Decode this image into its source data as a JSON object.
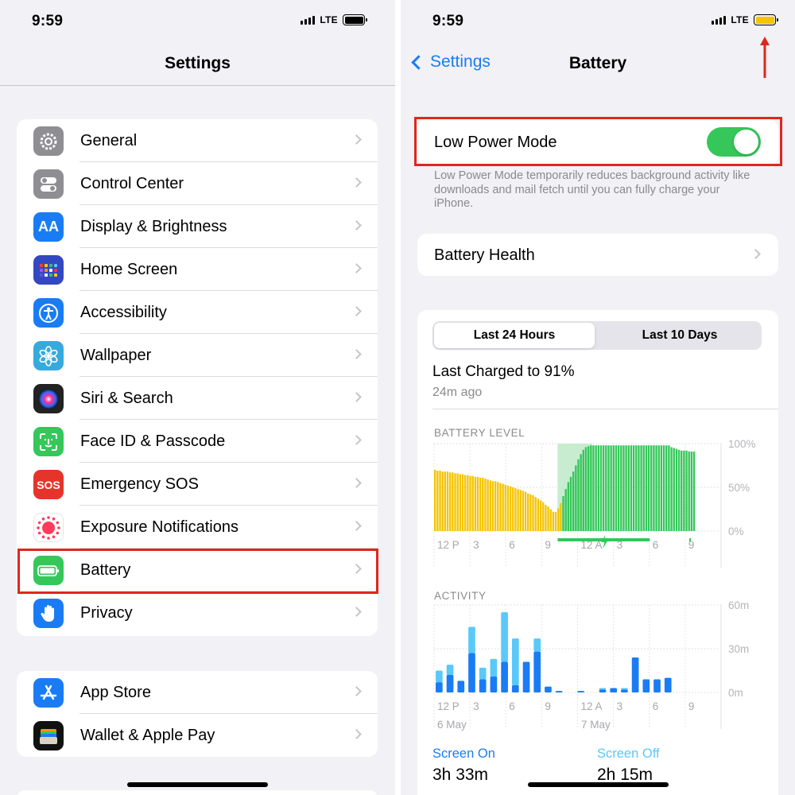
{
  "status": {
    "time": "9:59",
    "network": "LTE"
  },
  "left": {
    "nav_title": "Settings",
    "group1": [
      {
        "label": "General",
        "icon": "gear-icon",
        "color": "#8e8e93"
      },
      {
        "label": "Control Center",
        "icon": "switches-icon",
        "color": "#8e8e93"
      },
      {
        "label": "Display & Brightness",
        "icon": "text-size-icon",
        "icon_text": "AA",
        "color": "#1a7cf5"
      },
      {
        "label": "Home Screen",
        "icon": "app-grid-icon",
        "color": "#3447c2"
      },
      {
        "label": "Accessibility",
        "icon": "accessibility-icon",
        "color": "#1a7cf5"
      },
      {
        "label": "Wallpaper",
        "icon": "flower-icon",
        "color": "#36aadc"
      },
      {
        "label": "Siri & Search",
        "icon": "siri-icon",
        "color": "#222"
      },
      {
        "label": "Face ID & Passcode",
        "icon": "face-id-icon",
        "color": "#35c759"
      },
      {
        "label": "Emergency SOS",
        "icon": "sos-icon",
        "icon_text": "SOS",
        "color": "#e5352b"
      },
      {
        "label": "Exposure Notifications",
        "icon": "exposure-icon",
        "color": "#ffffff"
      },
      {
        "label": "Battery",
        "icon": "battery-icon",
        "color": "#35c759",
        "highlighted": true
      },
      {
        "label": "Privacy",
        "icon": "hand-icon",
        "color": "#1a7cf5"
      }
    ],
    "group2": [
      {
        "label": "App Store",
        "icon": "app-store-icon",
        "color": "#1a7cf5"
      },
      {
        "label": "Wallet & Apple Pay",
        "icon": "wallet-icon",
        "color": "#111"
      }
    ]
  },
  "right": {
    "back_label": "Settings",
    "nav_title": "Battery",
    "low_power": {
      "label": "Low Power Mode",
      "on": true,
      "description": "Low Power Mode temporarily reduces background activity like downloads and mail fetch until you can fully charge your iPhone."
    },
    "battery_health_label": "Battery Health",
    "tabs": [
      "Last 24 Hours",
      "Last 10 Days"
    ],
    "selected_tab": "Last 24 Hours",
    "last_charged": "Last Charged to 91%",
    "last_charged_ago": "24m ago",
    "screen_on": {
      "label": "Screen On",
      "value": "3h 33m"
    },
    "screen_off": {
      "label": "Screen Off",
      "value": "2h 15m"
    },
    "colors": {
      "accent": "#1a7cf5",
      "battery_yellow": "#f5c400",
      "battery_green": "#35c759",
      "screen_on": "#1a7cf5",
      "screen_off": "#5ac8fa",
      "highlight": "#e0261c"
    }
  },
  "chart_data": [
    {
      "type": "bar",
      "title": "BATTERY LEVEL",
      "ylim": [
        0,
        100
      ],
      "y_ticks": [
        "100%",
        "50%",
        "0%"
      ],
      "x_ticks": [
        "12 P",
        "3",
        "6",
        "9",
        "12 A",
        "3",
        "6",
        "9"
      ],
      "series": [
        {
          "name": "battery",
          "values": [
            70,
            69,
            69,
            68,
            68,
            68,
            67,
            67,
            66,
            66,
            65,
            65,
            64,
            64,
            63,
            63,
            62,
            62,
            61,
            61,
            60,
            59,
            58,
            57,
            57,
            56,
            55,
            54,
            53,
            52,
            51,
            50,
            49,
            48,
            47,
            46,
            45,
            43,
            42,
            41,
            39,
            37,
            35,
            33,
            30,
            28,
            25,
            22,
            22,
            26,
            32,
            40,
            48,
            56,
            62,
            68,
            75,
            82,
            88,
            93,
            96,
            97,
            98,
            98,
            98,
            98,
            98,
            98,
            98,
            98,
            98,
            98,
            98,
            98,
            98,
            98,
            98,
            98,
            98,
            98,
            98,
            98,
            98,
            98,
            98,
            98,
            98,
            98,
            98,
            98,
            98,
            98,
            98,
            98,
            96,
            95,
            94,
            93,
            92,
            92,
            92,
            91,
            91,
            91
          ],
          "charging": [
            false,
            false,
            false,
            false,
            false,
            false,
            false,
            false,
            false,
            false,
            false,
            false,
            false,
            false,
            false,
            false,
            false,
            false,
            false,
            false,
            false,
            false,
            false,
            false,
            false,
            false,
            false,
            false,
            false,
            false,
            false,
            false,
            false,
            false,
            false,
            false,
            false,
            false,
            false,
            false,
            false,
            false,
            false,
            false,
            false,
            false,
            false,
            false,
            false,
            false,
            false,
            true,
            true,
            true,
            true,
            true,
            true,
            true,
            true,
            true,
            true,
            true,
            true,
            true,
            true,
            true,
            true,
            true,
            true,
            true,
            true,
            true,
            true,
            true,
            true,
            true,
            true,
            true,
            true,
            true,
            true,
            true,
            true,
            true,
            true,
            true,
            true,
            true,
            true,
            true,
            true,
            true,
            true,
            true,
            true,
            true,
            true,
            true,
            true,
            true,
            true,
            true,
            true,
            true
          ]
        }
      ]
    },
    {
      "type": "bar",
      "title": "ACTIVITY",
      "ylim": [
        0,
        60
      ],
      "y_ticks": [
        "60m",
        "30m",
        "0m"
      ],
      "x_ticks": [
        "12 P",
        "3",
        "6",
        "9",
        "12 A",
        "3",
        "6",
        "9"
      ],
      "date_labels": [
        "6 May",
        "7 May"
      ],
      "categories": [
        0,
        1,
        2,
        3,
        4,
        5,
        6,
        7,
        8,
        9,
        10,
        11,
        12,
        13,
        14,
        15,
        16,
        17,
        18,
        19,
        20,
        21,
        22,
        23
      ],
      "series": [
        {
          "name": "Screen On",
          "values": [
            7,
            12,
            8,
            27,
            9,
            11,
            21,
            5,
            21,
            28,
            4,
            1,
            0,
            1,
            0,
            2,
            3,
            2,
            24,
            9,
            9,
            10,
            0,
            0
          ]
        },
        {
          "name": "Screen Off",
          "values": [
            8,
            7,
            0,
            18,
            8,
            12,
            34,
            32,
            0,
            9,
            0,
            0,
            0,
            0,
            0,
            1,
            0,
            1,
            0,
            0,
            0,
            0,
            0,
            0
          ]
        }
      ]
    }
  ]
}
